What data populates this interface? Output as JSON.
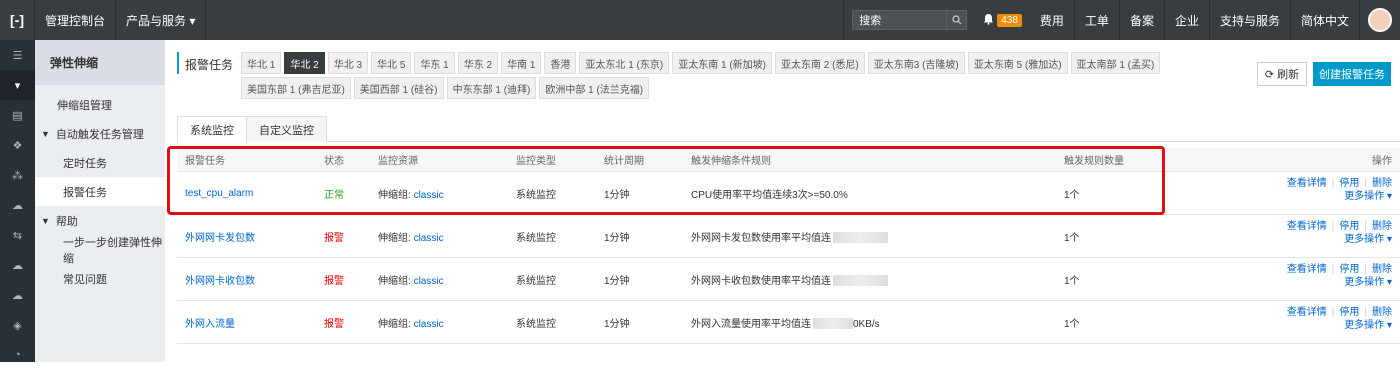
{
  "topbar": {
    "logo": "[-]",
    "console": "管理控制台",
    "products": "产品与服务 ▾",
    "search_placeholder": "搜索",
    "notif_count": "438",
    "items": [
      "费用",
      "工单",
      "备案",
      "企业",
      "支持与服务",
      "简体中文"
    ]
  },
  "nav": {
    "title": "弹性伸缩",
    "scaling_group_mgmt": "伸缩组管理",
    "auto_trigger_group": "自动触发任务管理",
    "scheduled_task": "定时任务",
    "alarm_task": "报警任务",
    "help_group": "帮助",
    "step_by_step": "一步一步创建弹性伸缩",
    "faq": "常见问题"
  },
  "main": {
    "section_label": "报警任务",
    "regions": [
      "华北 1",
      "华北 2",
      "华北 3",
      "华北 5",
      "华东 1",
      "华东 2",
      "华南 1",
      "香港",
      "亚太东北 1 (东京)",
      "亚太东南 1 (新加坡)",
      "亚太东南 2 (悉尼)",
      "亚太东南3 (吉隆坡)",
      "亚太东南 5 (雅加达)",
      "亚太南部 1 (孟买)",
      "美国东部 1 (弗吉尼亚)",
      "美国西部 1 (硅谷)",
      "中东东部 1 (迪拜)",
      "欧洲中部 1 (法兰克福)"
    ],
    "active_region": "华北 2",
    "refresh_label": "刷新",
    "create_label": "创建报警任务",
    "tabs": [
      "系统监控",
      "自定义监控"
    ],
    "active_tab": "系统监控"
  },
  "table": {
    "headers": [
      "报警任务",
      "状态",
      "监控资源",
      "监控类型",
      "统计周期",
      "触发伸缩条件规则",
      "触发规则数量",
      "操作"
    ],
    "rows": [
      {
        "name": "test_cpu_alarm",
        "status": "正常",
        "status_kind": "ok",
        "resource_prefix": "伸缩组:",
        "resource": "classic",
        "type": "系统监控",
        "period": "1分钟",
        "rule": "CPU使用率平均值连续3次>=50.0%",
        "count": "1个"
      },
      {
        "name": "外网网卡发包数",
        "status": "报警",
        "status_kind": "alert",
        "resource_prefix": "伸缩组:",
        "resource": "classic",
        "type": "系统监控",
        "period": "1分钟",
        "rule": "外网网卡发包数使用率平均值连",
        "count": "1个"
      },
      {
        "name": "外网网卡收包数",
        "status": "报警",
        "status_kind": "alert",
        "resource_prefix": "伸缩组:",
        "resource": "classic",
        "type": "系统监控",
        "period": "1分钟",
        "rule": "外网网卡收包数使用率平均值连",
        "count": "1个"
      },
      {
        "name": "外网入流量",
        "status": "报警",
        "status_kind": "alert",
        "resource_prefix": "伸缩组:",
        "resource": "classic",
        "type": "系统监控",
        "period": "1分钟",
        "rule": "外网入流量使用率平均值连",
        "rule_suffix": "0KB/s",
        "count": "1个"
      }
    ],
    "op_detail": "查看详情",
    "op_disable": "停用",
    "op_delete": "删除",
    "op_more": "更多操作 ▾"
  }
}
